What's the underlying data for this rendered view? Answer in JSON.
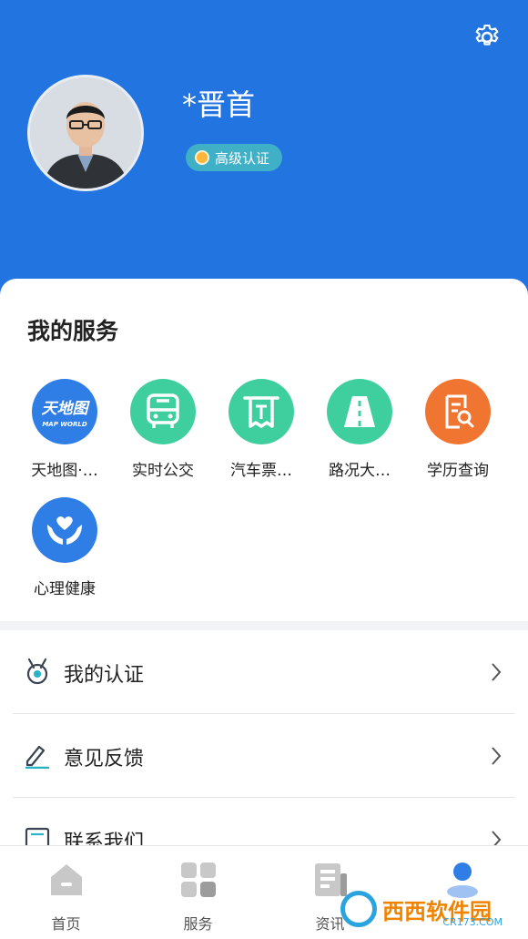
{
  "profile": {
    "username": "*晋首",
    "cert_badge": "高级认证"
  },
  "services": {
    "title": "我的服务",
    "items": [
      {
        "label": "天地图·…",
        "icon": "tianditu-map-icon",
        "logo_text": "天地图",
        "logo_sub": "MAP WORLD",
        "color": "#2f7ee6"
      },
      {
        "label": "实时公交",
        "icon": "bus-icon",
        "color": "#3fcf9e"
      },
      {
        "label": "汽车票…",
        "icon": "ticket-icon",
        "color": "#3fcf9e"
      },
      {
        "label": "路况大…",
        "icon": "road-icon",
        "color": "#3fcf9e"
      },
      {
        "label": "学历查询",
        "icon": "document-search-icon",
        "color": "#f07530"
      },
      {
        "label": "心理健康",
        "icon": "heart-hands-icon",
        "color": "#2f7ee6"
      }
    ]
  },
  "menu": [
    {
      "label": "我的认证",
      "icon": "medal-icon"
    },
    {
      "label": "意见反馈",
      "icon": "edit-feedback-icon"
    },
    {
      "label": "联系我们",
      "icon": "contact-icon"
    }
  ],
  "tabs": [
    {
      "label": "首页",
      "icon": "home-icon",
      "active": false
    },
    {
      "label": "服务",
      "icon": "grid-icon",
      "active": false
    },
    {
      "label": "资讯",
      "icon": "news-icon",
      "active": false
    },
    {
      "label": "",
      "icon": "user-icon",
      "active": true
    }
  ],
  "watermark": {
    "text": "西西软件园",
    "sub": "CR173.COM"
  },
  "colors": {
    "header_blue": "#2274e0",
    "accent_green": "#3fcf9e",
    "accent_orange": "#f07530",
    "tab_active": "#2f7ee6",
    "tab_inactive": "#c8c8c8"
  }
}
